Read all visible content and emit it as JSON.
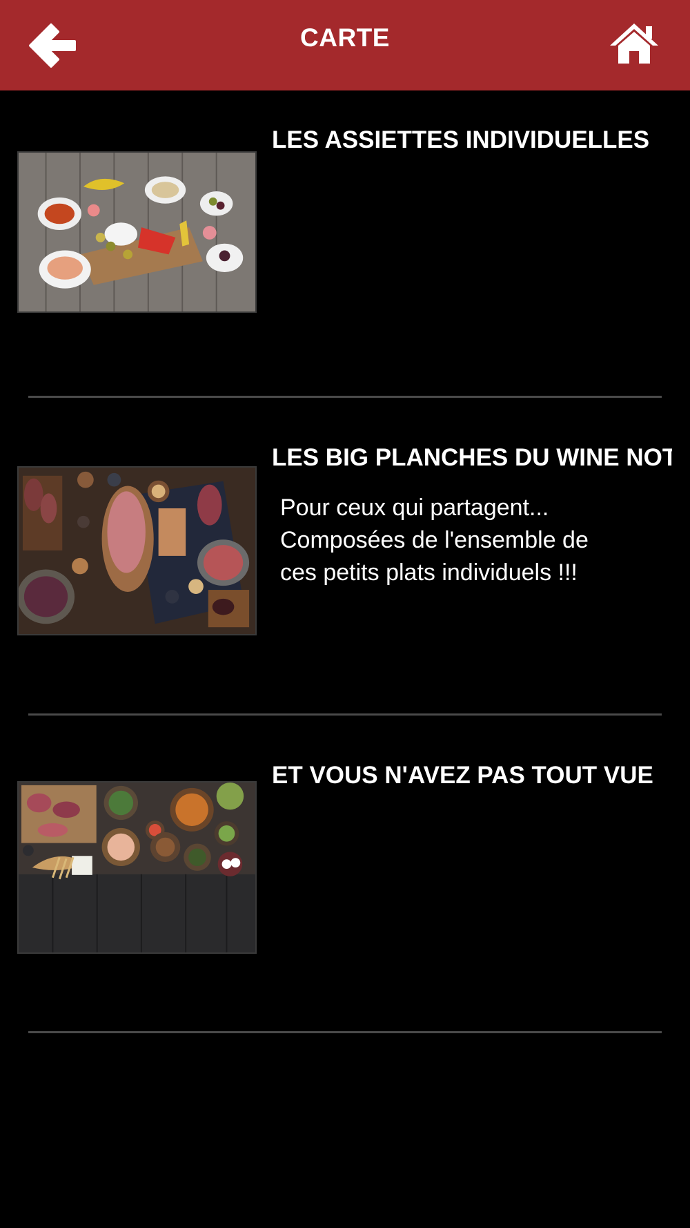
{
  "header": {
    "title": "CARTE",
    "back_icon": "arrow-left-icon",
    "home_icon": "home-icon",
    "color": "#a4292c"
  },
  "items": [
    {
      "title": "LES ASSIETTES INDIVIDUELLES",
      "description": "",
      "image": "food-platter-image"
    },
    {
      "title": "LES BIG PLANCHES DU WINE NOT",
      "description_lines": [
        "Pour ceux qui partagent...",
        "Composées de l'ensemble de",
        "ces petits plats individuels !!!"
      ],
      "image": "charcuterie-board-image"
    },
    {
      "title": "ET VOUS N'AVEZ PAS TOUT VUE",
      "description": "",
      "image": "table-spread-image"
    }
  ]
}
